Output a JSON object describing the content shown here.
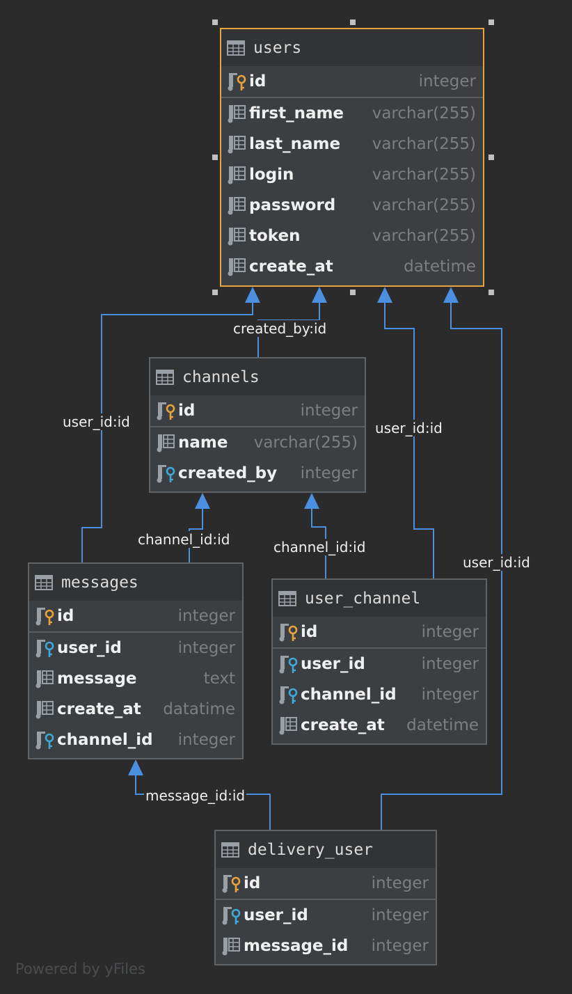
{
  "tables": {
    "users": {
      "name": "users",
      "pk": {
        "name": "id",
        "type": "integer"
      },
      "columns": [
        {
          "name": "first_name",
          "type": "varchar(255)",
          "kind": "column"
        },
        {
          "name": "last_name",
          "type": "varchar(255)",
          "kind": "column"
        },
        {
          "name": "login",
          "type": "varchar(255)",
          "kind": "column"
        },
        {
          "name": "password",
          "type": "varchar(255)",
          "kind": "column"
        },
        {
          "name": "token",
          "type": "varchar(255)",
          "kind": "column"
        },
        {
          "name": "create_at",
          "type": "datetime",
          "kind": "column"
        }
      ]
    },
    "channels": {
      "name": "channels",
      "pk": {
        "name": "id",
        "type": "integer"
      },
      "columns": [
        {
          "name": "name",
          "type": "varchar(255)",
          "kind": "column"
        },
        {
          "name": "created_by",
          "type": "integer",
          "kind": "fk"
        }
      ]
    },
    "messages": {
      "name": "messages",
      "pk": {
        "name": "id",
        "type": "integer"
      },
      "columns": [
        {
          "name": "user_id",
          "type": "integer",
          "kind": "fk"
        },
        {
          "name": "message",
          "type": "text",
          "kind": "column"
        },
        {
          "name": "create_at",
          "type": "datatime",
          "kind": "column"
        },
        {
          "name": "channel_id",
          "type": "integer",
          "kind": "fk"
        }
      ]
    },
    "user_channel": {
      "name": "user_channel",
      "pk": {
        "name": "id",
        "type": "integer"
      },
      "columns": [
        {
          "name": "user_id",
          "type": "integer",
          "kind": "fk"
        },
        {
          "name": "channel_id",
          "type": "integer",
          "kind": "fk"
        },
        {
          "name": "create_at",
          "type": "datetime",
          "kind": "column"
        }
      ]
    },
    "delivery_user": {
      "name": "delivery_user",
      "pk": {
        "name": "id",
        "type": "integer"
      },
      "columns": [
        {
          "name": "user_id",
          "type": "integer",
          "kind": "fk"
        },
        {
          "name": "message_id",
          "type": "integer",
          "kind": "column"
        }
      ]
    }
  },
  "edge_labels": {
    "created_by": "created_by:id",
    "messages_user": "user_id:id",
    "user_channel_user": "user_id:id",
    "delivery_user_user": "user_id:id",
    "messages_channel": "channel_id:id",
    "user_channel_channel": "channel_id:id",
    "delivery_message": "message_id:id"
  },
  "colors": {
    "edge": "#4a8fe0",
    "pk_key": "#e8a33d",
    "fk_key": "#3fa9d9",
    "selected_border": "#e8a33d"
  },
  "footer": "Powered by yFiles"
}
